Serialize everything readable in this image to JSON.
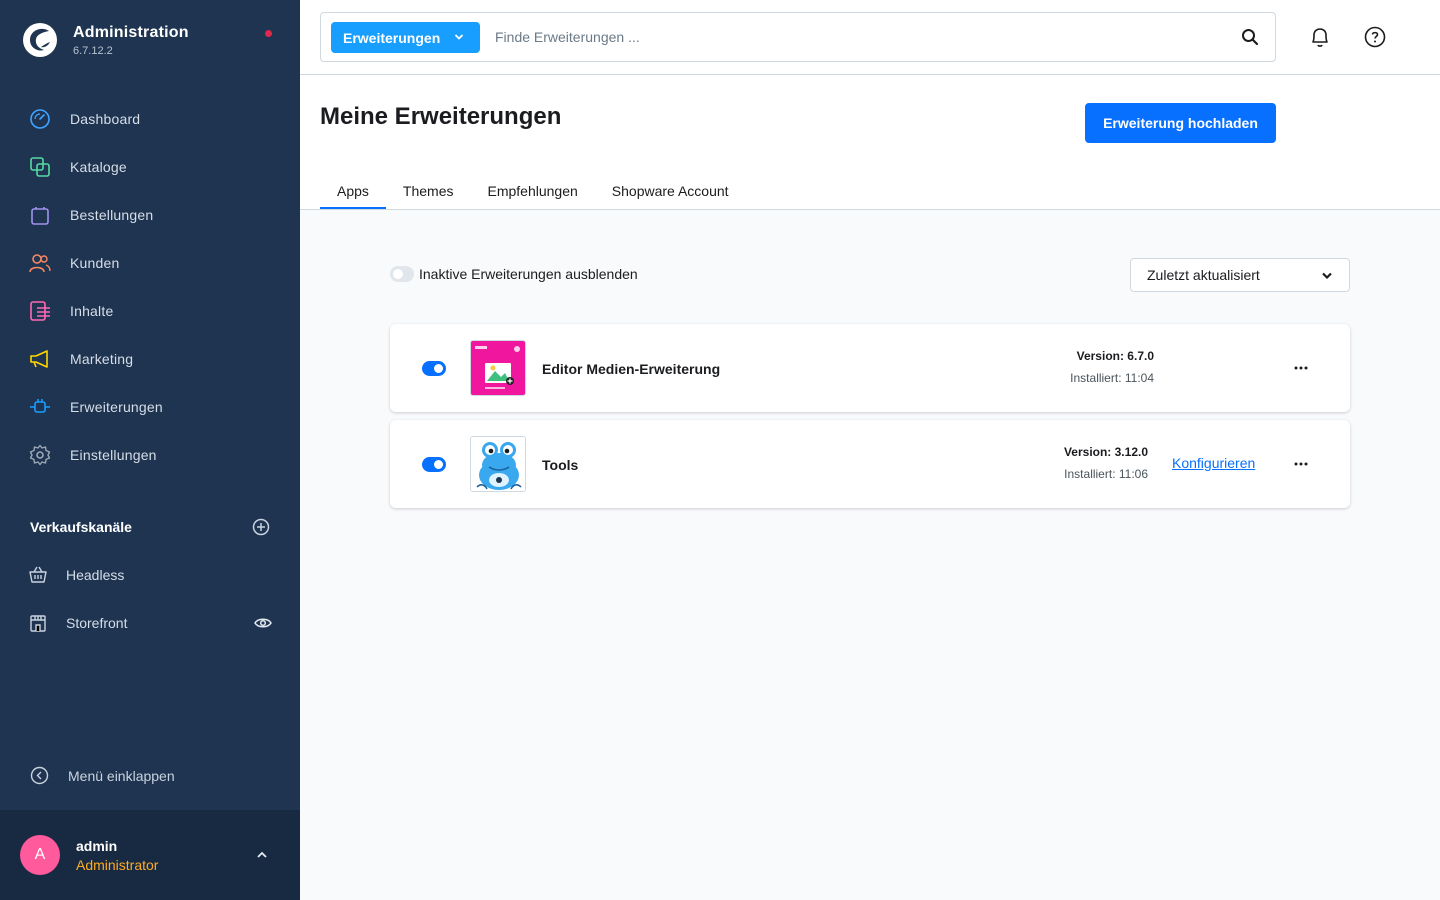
{
  "app": {
    "title": "Administration",
    "version": "6.7.12.2"
  },
  "nav": [
    {
      "label": "Dashboard",
      "icon": "dashboard-icon",
      "color": "#40a3ff"
    },
    {
      "label": "Kataloge",
      "icon": "catalog-icon",
      "color": "#57d9a3"
    },
    {
      "label": "Bestellungen",
      "icon": "shopping-bag-icon",
      "color": "#a092f0"
    },
    {
      "label": "Kunden",
      "icon": "users-icon",
      "color": "#f88962"
    },
    {
      "label": "Inhalte",
      "icon": "content-icon",
      "color": "#ff68b4"
    },
    {
      "label": "Marketing",
      "icon": "megaphone-icon",
      "color": "#ffd700"
    },
    {
      "label": "Erweiterungen",
      "icon": "plug-icon",
      "color": "#189eff"
    },
    {
      "label": "Einstellungen",
      "icon": "gear-icon",
      "color": "#9aa8b5"
    }
  ],
  "sales_channels": {
    "title": "Verkaufskanäle",
    "items": [
      {
        "label": "Headless",
        "icon": "basket-icon"
      },
      {
        "label": "Storefront",
        "icon": "storefront-icon"
      }
    ]
  },
  "collapse_label": "Menü einklappen",
  "user": {
    "initial": "A",
    "name": "admin",
    "role": "Administrator"
  },
  "search": {
    "type_label": "Erweiterungen",
    "placeholder": "Finde Erweiterungen ..."
  },
  "page": {
    "title": "Meine Erweiterungen",
    "upload_label": "Erweiterung hochladen",
    "tabs": [
      "Apps",
      "Themes",
      "Empfehlungen",
      "Shopware Account"
    ],
    "active_tab": "Apps"
  },
  "filter": {
    "hide_inactive_label": "Inaktive Erweiterungen ausblenden",
    "sort_value": "Zuletzt aktualisiert"
  },
  "extensions": [
    {
      "name": "Editor Medien-Erweiterung",
      "version": "Version: 6.7.0",
      "installed": "Installiert: 11:04",
      "active": true,
      "configure": ""
    },
    {
      "name": "Tools",
      "version": "Version: 3.12.0",
      "installed": "Installiert: 11:06",
      "active": true,
      "configure": "Konfigurieren"
    }
  ],
  "colors": {
    "sidebar": "#1f3450",
    "primary": "#0870ff",
    "accent": "#189eff",
    "role": "#ffab22",
    "avatar": "#ff5a9c"
  }
}
